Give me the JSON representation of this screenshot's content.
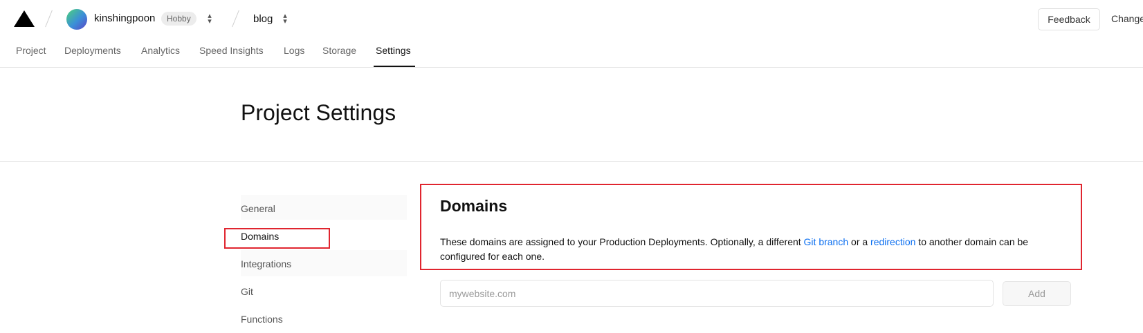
{
  "header": {
    "team_name": "kinshingpoon",
    "team_badge": "Hobby",
    "project_name": "blog",
    "feedback_label": "Feedback",
    "changelog_label": "Change"
  },
  "tabs": [
    {
      "label": "Project"
    },
    {
      "label": "Deployments"
    },
    {
      "label": "Analytics"
    },
    {
      "label": "Speed Insights"
    },
    {
      "label": "Logs"
    },
    {
      "label": "Storage"
    },
    {
      "label": "Settings",
      "active": true
    }
  ],
  "page": {
    "title": "Project Settings"
  },
  "sidebar": {
    "items": [
      {
        "label": "General"
      },
      {
        "label": "Domains",
        "active": true
      },
      {
        "label": "Integrations"
      },
      {
        "label": "Git"
      },
      {
        "label": "Functions"
      }
    ]
  },
  "domains": {
    "title": "Domains",
    "desc_part1": "These domains are assigned to your Production Deployments. Optionally, a different ",
    "link_git_branch": "Git branch",
    "desc_part2": " or a ",
    "link_redirection": "redirection",
    "desc_part3": " to another domain can be configured for each one.",
    "input_value": "",
    "input_placeholder": "mywebsite.com",
    "add_label": "Add"
  },
  "colors": {
    "accent_link": "#0a6ef0",
    "highlight_box": "#e0252f"
  }
}
